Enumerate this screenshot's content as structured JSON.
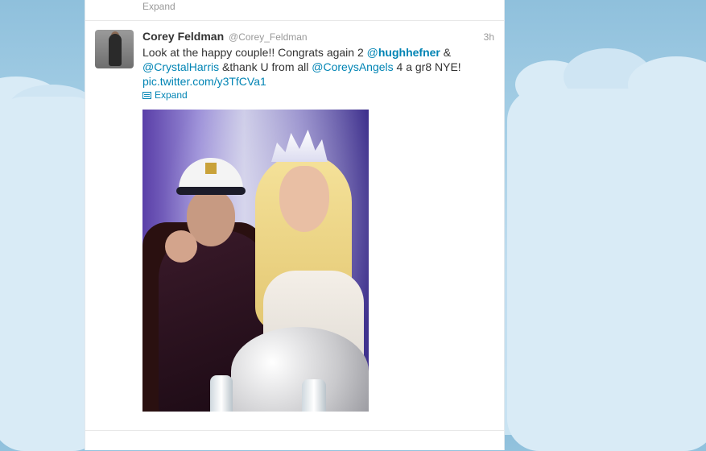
{
  "previous_tweet": {
    "expand_label": "Expand"
  },
  "tweet": {
    "fullname": "Corey Feldman",
    "screen_name": "@Corey_Feldman",
    "time": "3h",
    "text": {
      "part1": "Look at the happy couple!! Congrats again 2 ",
      "mention1_at": "@",
      "mention1_name": "hughhefner",
      "part2": " & ",
      "mention2": "@CrystalHarris",
      "part3": " &thank U from all ",
      "mention3": "@CoreysAngels",
      "part4": " 4 a gr8 NYE!",
      "pic_link": "pic.twitter.com/y3TfCVa1"
    },
    "expand_label": "Expand",
    "expand_icon": "photo-expand-icon"
  },
  "colors": {
    "link": "#0084b4",
    "name": "#333333",
    "muted": "#999999",
    "background_sky": "#a6cfe6"
  }
}
